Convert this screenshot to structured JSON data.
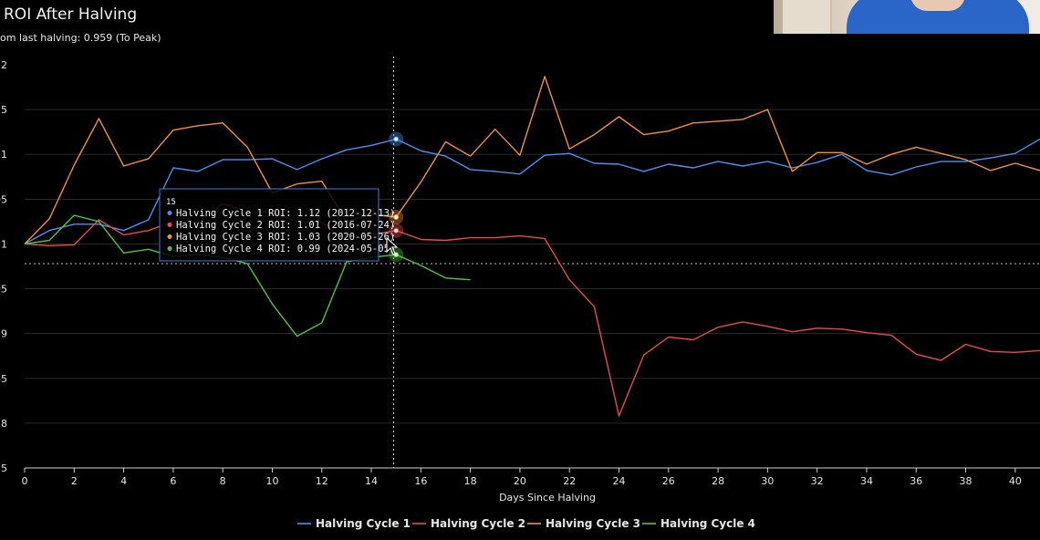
{
  "header": {
    "title": "ROI After Halving",
    "subtitle": "om last halving: 0.959 (To Peak)"
  },
  "chart_data": {
    "type": "line",
    "xlabel": "Days Since Halving",
    "ylabel": "",
    "xlim": [
      0,
      41
    ],
    "ylim": [
      0.75,
      1.2
    ],
    "x_ticks": [
      0,
      2,
      4,
      6,
      8,
      10,
      12,
      14,
      16,
      18,
      20,
      22,
      24,
      26,
      28,
      30,
      32,
      34,
      36,
      38,
      40
    ],
    "y_ticks": [
      {
        "value": 1.2,
        "label": ".2"
      },
      {
        "value": 1.15,
        "label": "15"
      },
      {
        "value": 1.1,
        "label": ".1"
      },
      {
        "value": 1.05,
        "label": "05"
      },
      {
        "value": 1.0,
        "label": "1"
      },
      {
        "value": 0.95,
        "label": "95"
      },
      {
        "value": 0.9,
        "label": ".9"
      },
      {
        "value": 0.85,
        "label": "85"
      },
      {
        "value": 0.8,
        "label": ".8"
      },
      {
        "value": 0.75,
        "label": "75"
      }
    ],
    "grid": true,
    "legend_position": "bottom",
    "reference_line_y": 0.978,
    "crosshair_x": 14.9,
    "highlight_x": 15,
    "series": [
      {
        "name": "Halving Cycle 1",
        "color": "#4f8ff0",
        "x": [
          0,
          1,
          2,
          3,
          4,
          5,
          6,
          7,
          8,
          9,
          10,
          11,
          12,
          13,
          14,
          15,
          16,
          17,
          18,
          19,
          20,
          21,
          22,
          23,
          24,
          25,
          26,
          27,
          28,
          29,
          30,
          31,
          32,
          33,
          34,
          35,
          36,
          37,
          38,
          39,
          40,
          41
        ],
        "values": [
          1.0,
          1.015,
          1.022,
          1.022,
          1.015,
          1.027,
          1.085,
          1.081,
          1.094,
          1.094,
          1.095,
          1.083,
          1.095,
          1.105,
          1.11,
          1.117,
          1.104,
          1.098,
          1.083,
          1.081,
          1.078,
          1.099,
          1.101,
          1.09,
          1.089,
          1.081,
          1.089,
          1.085,
          1.092,
          1.087,
          1.092,
          1.085,
          1.091,
          1.1,
          1.082,
          1.077,
          1.086,
          1.092,
          1.092,
          1.096,
          1.101,
          1.117
        ]
      },
      {
        "name": "Halving Cycle 2",
        "color": "#e84b4b",
        "x": [
          0,
          1,
          2,
          3,
          4,
          5,
          6,
          7,
          8,
          9,
          10,
          11,
          12,
          13,
          14,
          15,
          16,
          17,
          18,
          19,
          20,
          21,
          22,
          23,
          24,
          25,
          26,
          27,
          28,
          29,
          30,
          31,
          32,
          33,
          34,
          35,
          36,
          37,
          38,
          39,
          40,
          41
        ],
        "values": [
          1.0,
          0.998,
          0.999,
          1.027,
          1.01,
          1.015,
          1.025,
          1.024,
          1.045,
          1.036,
          1.035,
          1.025,
          1.024,
          1.003,
          1.01,
          1.015,
          1.005,
          1.004,
          1.007,
          1.007,
          1.009,
          1.006,
          0.96,
          0.93,
          0.808,
          0.876,
          0.896,
          0.893,
          0.907,
          0.913,
          0.908,
          0.902,
          0.906,
          0.905,
          0.901,
          0.898,
          0.877,
          0.87,
          0.888,
          0.88,
          0.879,
          0.881
        ]
      },
      {
        "name": "Halving Cycle 3",
        "color": "#f0923a",
        "x": [
          0,
          1,
          2,
          3,
          4,
          5,
          6,
          7,
          8,
          9,
          10,
          11,
          12,
          13,
          14,
          15,
          16,
          17,
          18,
          19,
          20,
          21,
          22,
          23,
          24,
          25,
          26,
          27,
          28,
          29,
          30,
          31,
          32,
          33,
          34,
          35,
          36,
          37,
          38,
          39,
          40,
          41
        ],
        "values": [
          1.0,
          1.028,
          1.088,
          1.14,
          1.087,
          1.095,
          1.127,
          1.132,
          1.135,
          1.108,
          1.057,
          1.067,
          1.07,
          1.025,
          1.033,
          1.03,
          1.069,
          1.114,
          1.098,
          1.128,
          1.099,
          1.187,
          1.106,
          1.122,
          1.142,
          1.122,
          1.126,
          1.135,
          1.137,
          1.139,
          1.15,
          1.081,
          1.102,
          1.102,
          1.089,
          1.1,
          1.108,
          1.101,
          1.094,
          1.082,
          1.09,
          1.082
        ]
      },
      {
        "name": "Halving Cycle 4",
        "color": "#52c43a",
        "x": [
          0,
          1,
          2,
          3,
          4,
          5,
          6,
          7,
          8,
          9,
          10,
          11,
          12,
          13,
          14,
          15,
          16,
          17,
          18
        ],
        "values": [
          1.0,
          1.004,
          1.032,
          1.025,
          0.99,
          0.994,
          0.986,
          0.988,
          0.985,
          0.978,
          0.933,
          0.897,
          0.912,
          0.98,
          0.985,
          0.988,
          0.976,
          0.962,
          0.96
        ]
      }
    ]
  },
  "tooltip": {
    "header": "15",
    "rows": [
      {
        "text": "Halving Cycle 1 ROI: 1.12 (2012-12-13)",
        "color": "#4f8ff0"
      },
      {
        "text": "Halving Cycle 2 ROI: 1.01 (2016-07-24)",
        "color": "#e84b4b"
      },
      {
        "text": "Halving Cycle 3 ROI: 1.03 (2020-05-26)",
        "color": "#f0923a"
      },
      {
        "text": "Halving Cycle 4 ROI: 0.99 (2024-05-05)",
        "color": "#52c43a"
      }
    ]
  }
}
